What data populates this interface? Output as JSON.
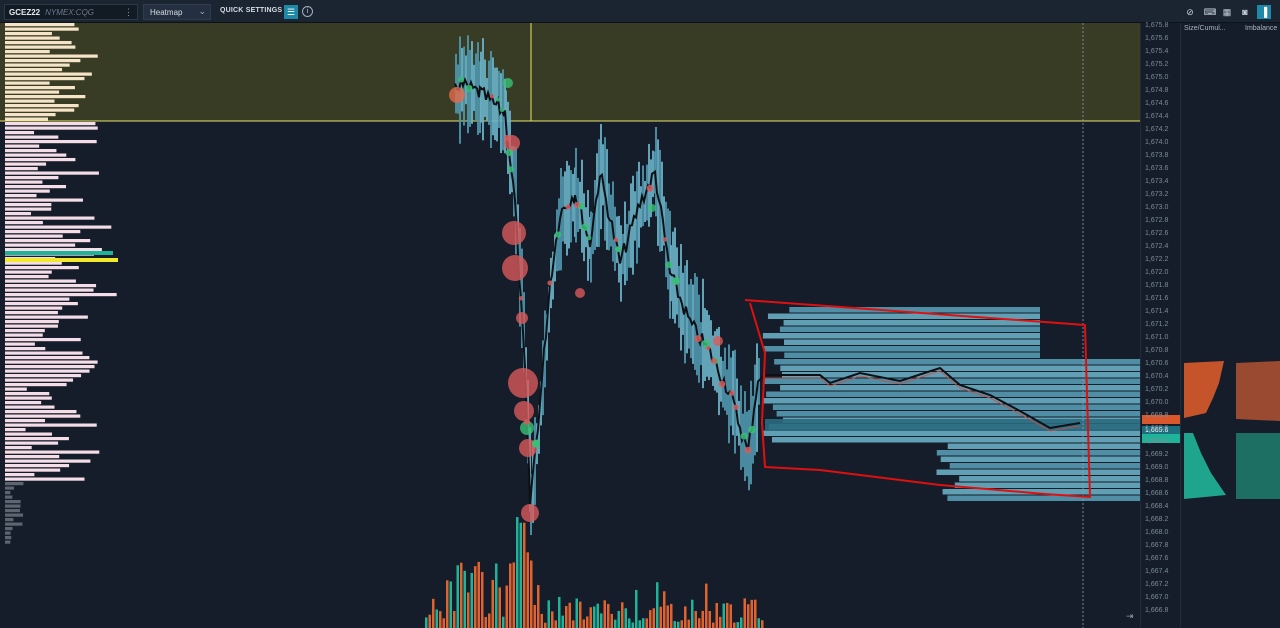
{
  "toolbar": {
    "symbol": "GCEZ22",
    "exchange": "NYMEX:CQG",
    "chart_type": "Heatmap",
    "quick_settings": "QUICK SETTINGS"
  },
  "price_axis": {
    "ticks": [
      "1,675.8",
      "1,675.6",
      "1,675.4",
      "1,675.2",
      "1,675.0",
      "1,674.8",
      "1,674.6",
      "1,674.4",
      "1,674.2",
      "1,674.0",
      "1,673.8",
      "1,673.6",
      "1,673.4",
      "1,673.2",
      "1,673.0",
      "1,672.8",
      "1,672.6",
      "1,672.4",
      "1,672.2",
      "1,672.0",
      "1,671.8",
      "1,671.6",
      "1,671.4",
      "1,671.2",
      "1,671.0",
      "1,670.8",
      "1,670.6",
      "1,670.4",
      "1,670.2",
      "1,670.0",
      "1,669.8",
      "1,669.6",
      "1,669.4",
      "1,669.2",
      "1,669.0",
      "1,668.8",
      "1,668.6",
      "1,668.4",
      "1,668.2",
      "1,668.0",
      "1,667.8",
      "1,667.6",
      "1,667.4",
      "1,667.2",
      "1,667.0",
      "1,666.8"
    ],
    "current_price": "1,669.6"
  },
  "right_panel": {
    "col1": "Size/Cumul...",
    "col2": "Imbalance"
  },
  "colors": {
    "background": "#141d29",
    "heatmap": "#5fa8c2",
    "zone": "#3a3e24",
    "sell": "#e0622e",
    "buy": "#1fb39a",
    "annotation": "#e01010"
  }
}
